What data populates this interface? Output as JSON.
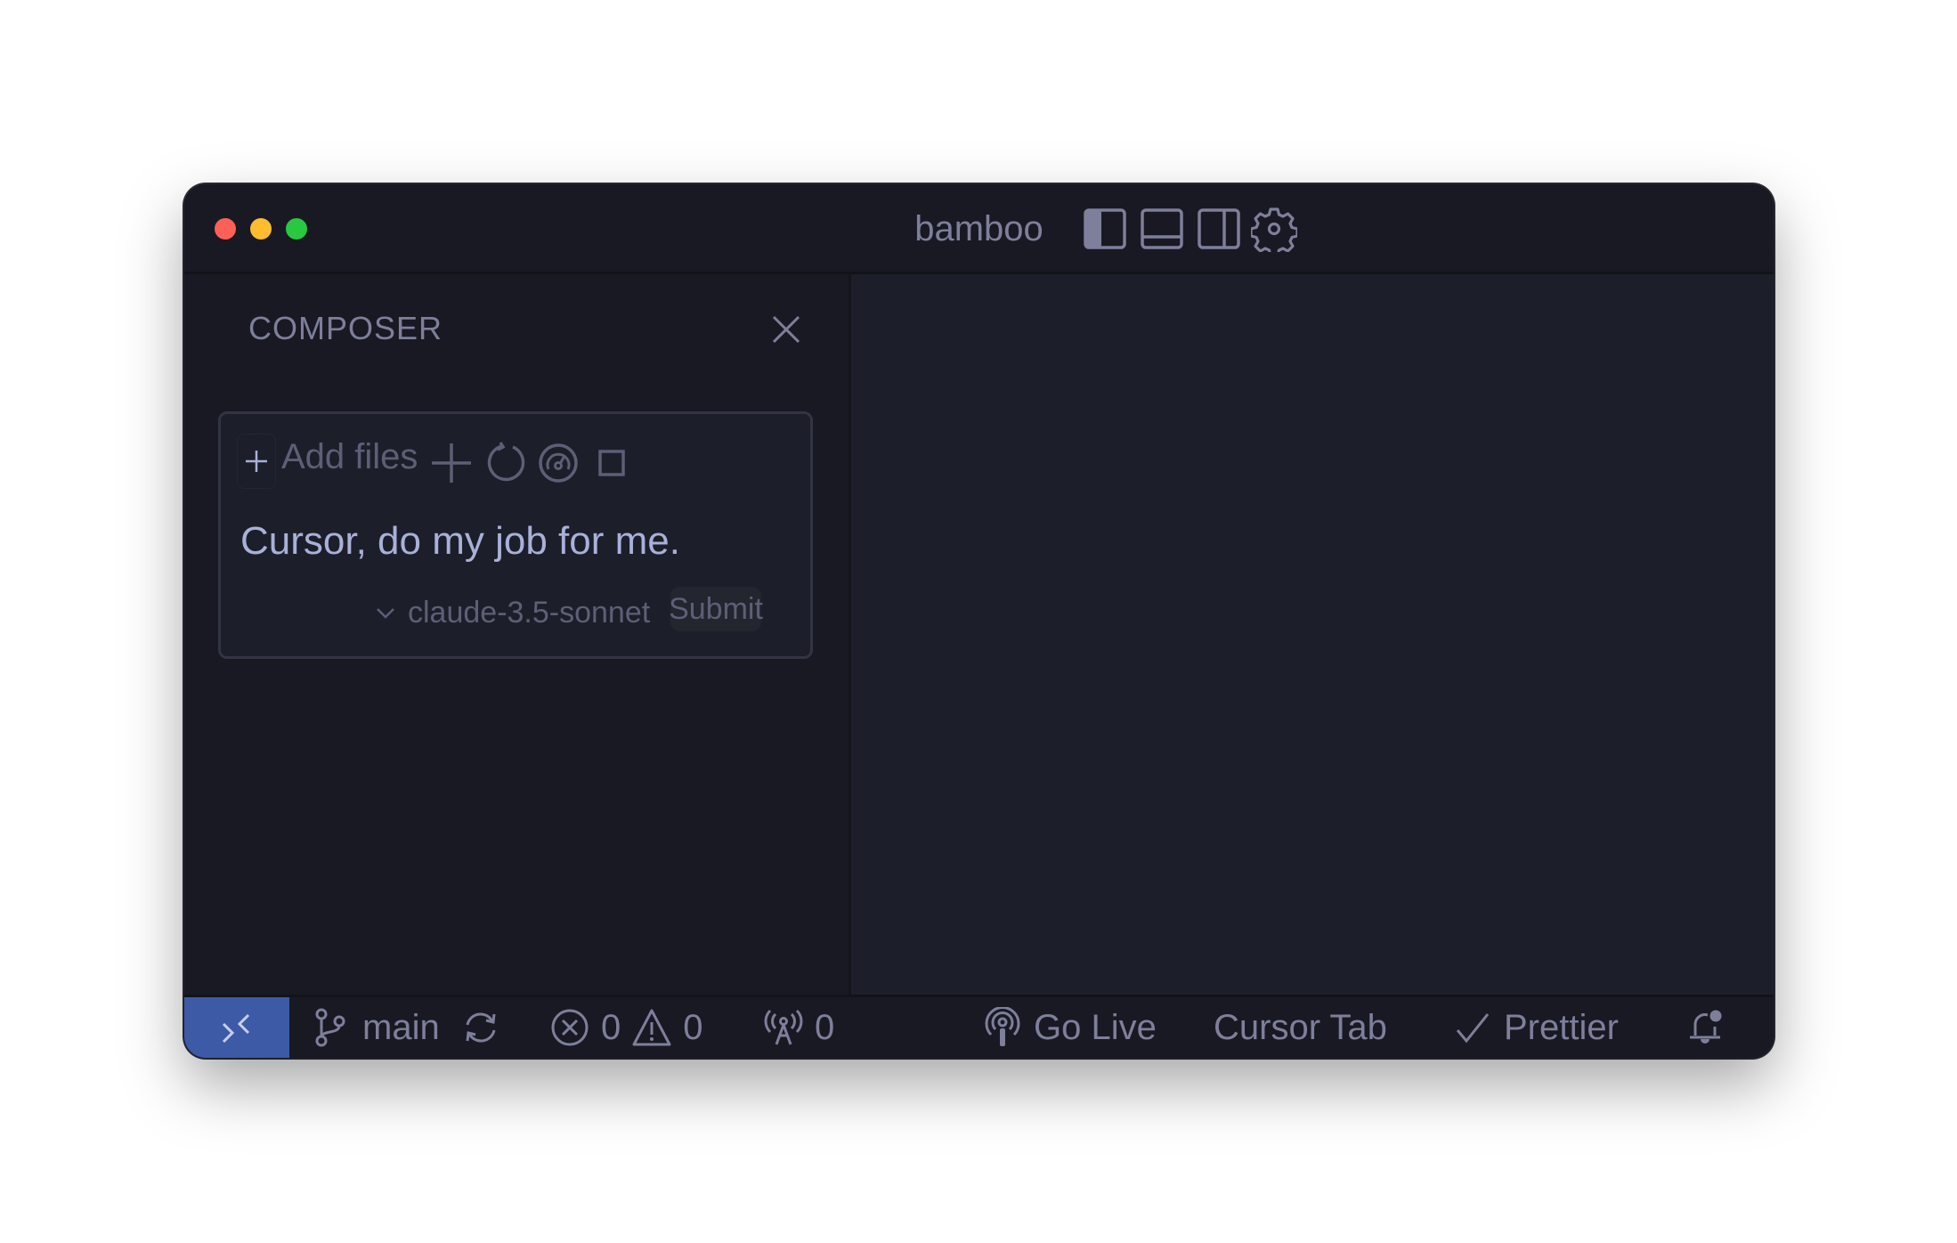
{
  "window": {
    "title": "bamboo",
    "traffic_lights": {
      "close": "#fe5f57",
      "minimize": "#febc2e",
      "zoom": "#28c840"
    },
    "title_bar_icons": [
      "toggle-primary-sidebar-icon",
      "toggle-panel-icon",
      "toggle-secondary-sidebar-icon",
      "gear-icon"
    ]
  },
  "sidebar": {
    "panel_title": "COMPOSER",
    "composer": {
      "add_files_label": "Add files",
      "toolbar_icons": [
        "plus-icon",
        "history-icon",
        "gauge-icon",
        "stop-square-icon"
      ],
      "prompt": "Cursor, do my job for me.",
      "model": "claude-3.5-sonnet",
      "submit_label": "Submit"
    }
  },
  "status_bar": {
    "remote_color": "#3c5aa6",
    "branch": "main",
    "errors": "0",
    "warnings": "0",
    "ports": "0",
    "go_live": "Go Live",
    "cursor_tab": "Cursor Tab",
    "prettier": "Prettier"
  }
}
